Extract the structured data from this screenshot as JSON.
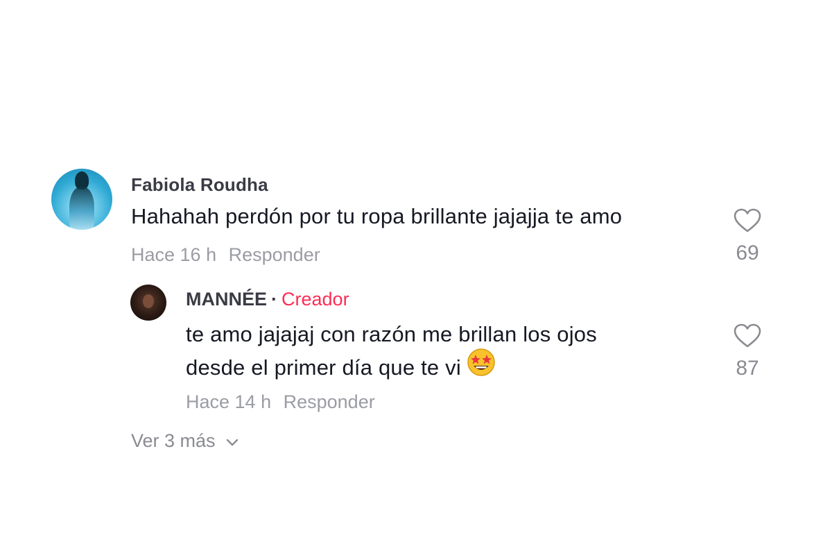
{
  "comment": {
    "username": "Fabiola Roudha",
    "text": "Hahahah perdón por tu ropa brillante jajajja te amo",
    "time": "Hace 16 h",
    "reply_label": "Responder",
    "likes": "69"
  },
  "reply": {
    "username": "MANNÉE",
    "separator": "·",
    "badge": "Creador",
    "text_line1": "te amo jajajaj con razón me brillan los ojos",
    "text_line2": "desde el primer día que te vi",
    "time": "Hace 14 h",
    "reply_label": "Responder",
    "likes": "87"
  },
  "view_more": {
    "label": "Ver 3 más"
  },
  "colors": {
    "creator_badge": "#fe2c55",
    "secondary_text": "#9b9ca3",
    "primary_text": "#161823"
  },
  "icons": {
    "like": "heart-outline-icon",
    "expand": "chevron-down-icon",
    "emoji": "star-struck-emoji"
  }
}
